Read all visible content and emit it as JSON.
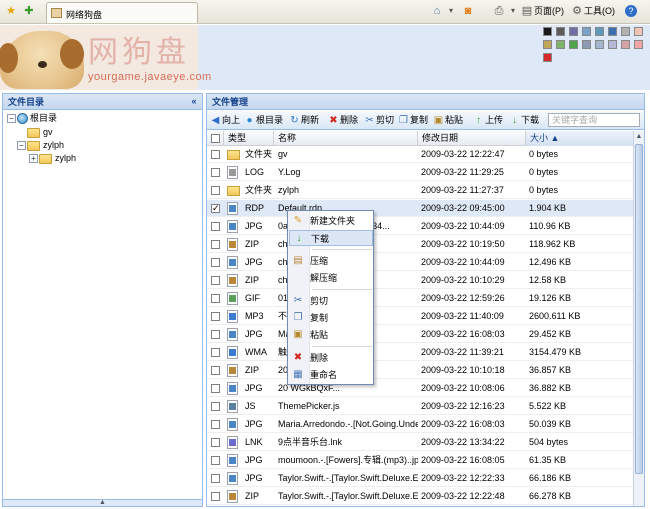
{
  "browser": {
    "tab_title": "网络狗盘",
    "page_menu": "页面(P)",
    "tools_menu": "工具(O)",
    "help": "?"
  },
  "header": {
    "logo_text": "网狗盘",
    "logo_url": "yourgame.javaeye.com",
    "theme_colors": [
      "#1a1a1a",
      "#5c5c5c",
      "#6f6fa6",
      "#7aa4c7",
      "#5d99b9",
      "#3e6fb1",
      "#b2b2b2",
      "#f0c5b6",
      "#c2a55c",
      "#7fb36c",
      "#4ea44a",
      "#8e9ab1",
      "#a4b5ce",
      "#b7b7d7",
      "#d4a4a4",
      "#f4a6a6",
      "#d42a2a"
    ]
  },
  "sidebar": {
    "title": "文件目录",
    "collapse_icon": "«",
    "tree": [
      {
        "label": "根目录",
        "level": 0,
        "expander": "−",
        "icon": "globe-icon"
      },
      {
        "label": "gv",
        "level": 1,
        "expander": "",
        "icon": "folder-icon"
      },
      {
        "label": "zylph",
        "level": 1,
        "expander": "−",
        "icon": "folder-icon"
      },
      {
        "label": "zylph",
        "level": 2,
        "expander": "+",
        "icon": "folder-icon"
      }
    ]
  },
  "main": {
    "title": "文件管理",
    "toolbar": {
      "up": "向上",
      "root": "根目录",
      "refresh": "刷新",
      "delete": "删除",
      "cut": "剪切",
      "copy": "复制",
      "paste": "粘贴",
      "upload": "上传",
      "download": "下载"
    },
    "search": {
      "placeholder": "关键字查询"
    },
    "columns": {
      "type": "类型",
      "name": "名称",
      "modified": "修改日期",
      "size": "大小 ▲"
    },
    "rows": [
      {
        "type": "文件夹",
        "name": "gv",
        "date": "2009-03-22 12:22:47",
        "size": "0 bytes",
        "checked": false,
        "folder": true
      },
      {
        "type": "LOG",
        "name": "Y.Log",
        "date": "2009-03-22 11:29:25",
        "size": "0 bytes",
        "checked": false,
        "folder": false
      },
      {
        "type": "文件夹",
        "name": "zylph",
        "date": "2009-03-22 11:27:37",
        "size": "0 bytes",
        "checked": false,
        "folder": true
      },
      {
        "type": "RDP",
        "name": "Default.rdp",
        "date": "2009-03-22 09:45:00",
        "size": "1.904 KB",
        "checked": true,
        "folder": false
      },
      {
        "type": "JPG",
        "name": "0a7e3c34f2fbf8c7b2f4834...",
        "date": "2009-03-22 10:44:09",
        "size": "110.96 KB",
        "checked": false,
        "folder": false
      },
      {
        "type": "ZIP",
        "name": "chi",
        "date": "2009-03-22 10:19:50",
        "size": "118.962 KB",
        "checked": false,
        "folder": false
      },
      {
        "type": "JPG",
        "name": "chi",
        "date": "2009-03-22 10:44:09",
        "size": "12.496 KB",
        "checked": false,
        "folder": false
      },
      {
        "type": "ZIP",
        "name": "chi",
        "date": "2009-03-22 10:10:29",
        "size": "12.58 KB",
        "checked": false,
        "folder": false
      },
      {
        "type": "GIF",
        "name": "01",
        "date": "2009-03-22 12:59:26",
        "size": "19.126 KB",
        "checked": false,
        "folder": false
      },
      {
        "type": "MP3",
        "name": "不",
        "date": "2009-03-22 11:40:09",
        "size": "2600.611 KB",
        "checked": false,
        "folder": false
      },
      {
        "type": "JPG",
        "name": "Ma                       s.-.1辑]...",
        "date": "2009-03-22 16:08:03",
        "size": "29.452 KB",
        "checked": false,
        "folder": false
      },
      {
        "type": "WMA",
        "name": "触",
        "date": "2009-03-22 11:39:21",
        "size": "3154.479 KB",
        "checked": false,
        "folder": false
      },
      {
        "type": "ZIP",
        "name": "20                       WGkBQxF...",
        "date": "2009-03-22 10:10:18",
        "size": "36.857 KB",
        "checked": false,
        "folder": false
      },
      {
        "type": "JPG",
        "name": "20                       WGkBQxF...",
        "date": "2009-03-22 10:08:06",
        "size": "36.882 KB",
        "checked": false,
        "folder": false
      },
      {
        "type": "JS",
        "name": "ThemePicker.js",
        "date": "2009-03-22 12:16:23",
        "size": "5.522 KB",
        "checked": false,
        "folder": false
      },
      {
        "type": "JPG",
        "name": "Maria.Arredondo.-.[Not.Going.Under]....",
        "date": "2009-03-22 16:08:03",
        "size": "50.039 KB",
        "checked": false,
        "folder": false
      },
      {
        "type": "LNK",
        "name": "9点半音乐台.lnk",
        "date": "2009-03-22 13:34:22",
        "size": "504 bytes",
        "checked": false,
        "folder": false
      },
      {
        "type": "JPG",
        "name": "moumoon.-.[Fowers].专辑.(mp3)..jpg",
        "date": "2009-03-22 16:08:05",
        "size": "61.35 KB",
        "checked": false,
        "folder": false
      },
      {
        "type": "JPG",
        "name": "Taylor.Swift.-.[Taylor.Swift.Deluxe.Ed...",
        "date": "2009-03-22 12:22:33",
        "size": "66.186 KB",
        "checked": false,
        "folder": false
      },
      {
        "type": "ZIP",
        "name": "Taylor.Swift.-.[Taylor.Swift.Deluxe.Ed...",
        "date": "2009-03-22 12:22:48",
        "size": "66.278 KB",
        "checked": false,
        "folder": false
      },
      {
        "type": "ZIP",
        "name": "Taylor.Swift.-.[Taylor.Swift.Deluxe.Ed...",
        "date": "2009-03-22 09:44:16",
        "size": "66.511 KB",
        "checked": false,
        "folder": false
      }
    ]
  },
  "context_menu": {
    "items": [
      {
        "label": "新建文件夹",
        "icon": "✎"
      },
      {
        "label": "下载",
        "icon": "↓"
      },
      {
        "label": "压缩",
        "icon": "▤"
      },
      {
        "label": "解压缩",
        "icon": ""
      },
      {
        "label": "剪切",
        "icon": "✂"
      },
      {
        "label": "复制",
        "icon": "❐"
      },
      {
        "label": "粘贴",
        "icon": "▣"
      },
      {
        "label": "删除",
        "icon": "✖"
      },
      {
        "label": "重命名",
        "icon": "▦"
      }
    ],
    "highlighted": 1
  }
}
